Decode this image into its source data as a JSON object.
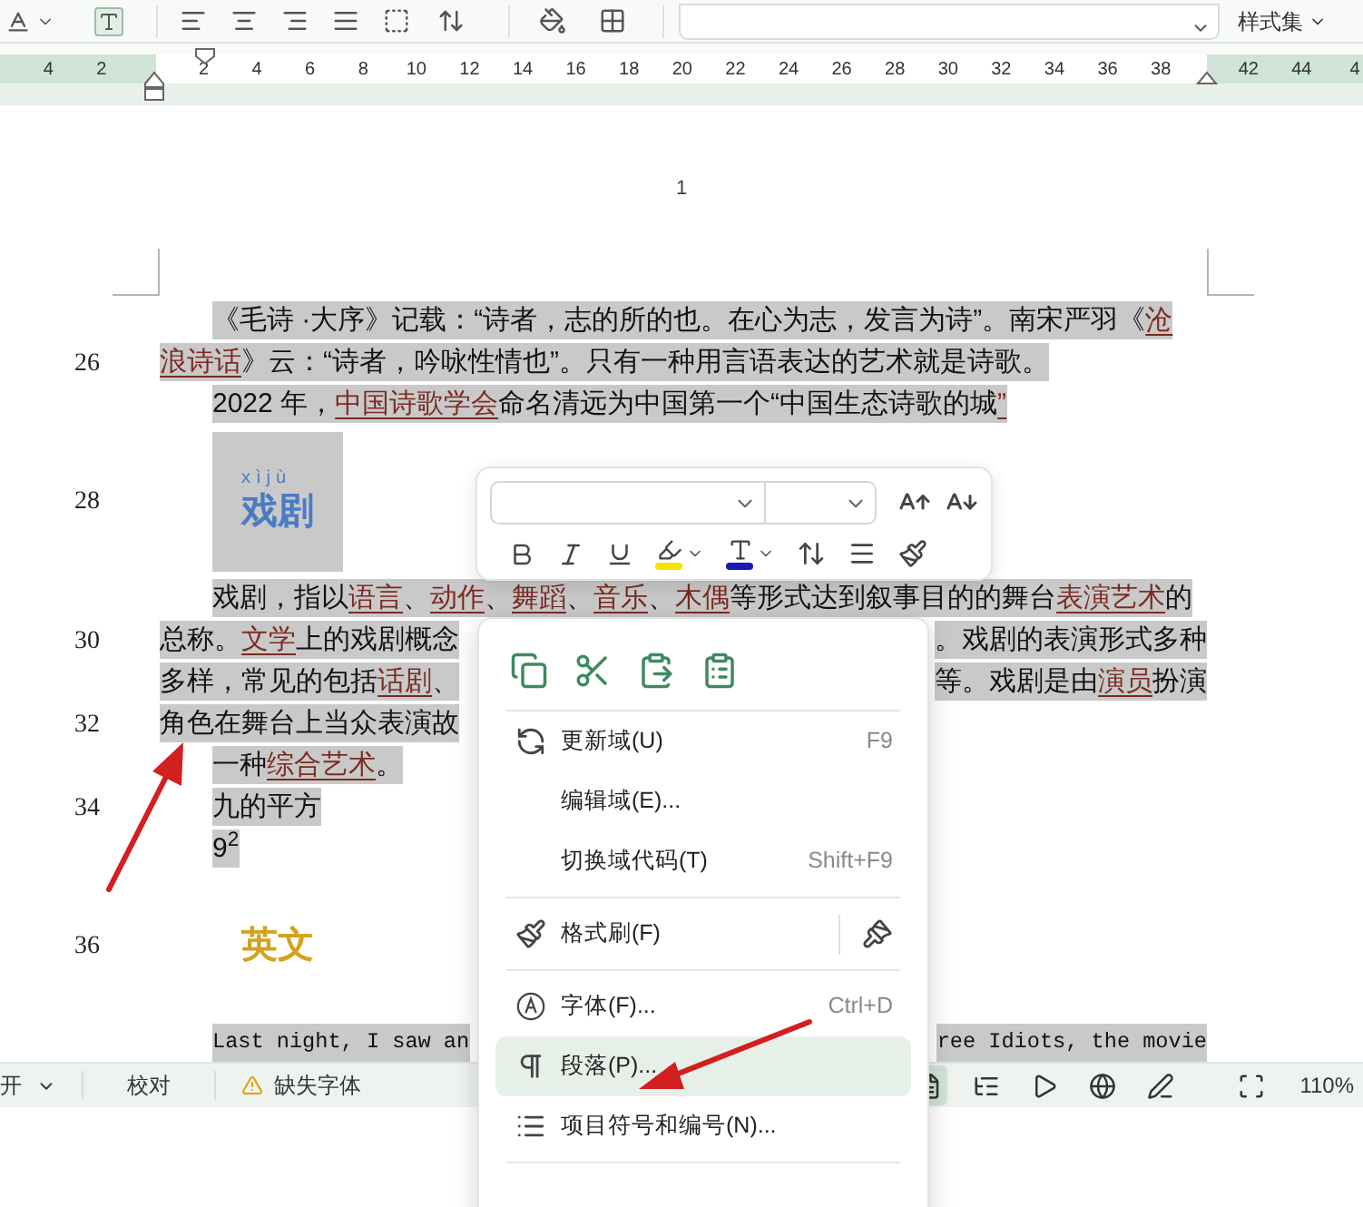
{
  "toolbar": {
    "style_set": "样式集"
  },
  "ruler": {
    "marks": [
      {
        "label": "4",
        "margin": true
      },
      {
        "label": "2",
        "margin": true
      },
      {
        "label": "2",
        "margin": false
      },
      {
        "label": "4",
        "margin": false
      },
      {
        "label": "6",
        "margin": false
      },
      {
        "label": "8",
        "margin": false
      },
      {
        "label": "10",
        "margin": false
      },
      {
        "label": "12",
        "margin": false
      },
      {
        "label": "14",
        "margin": false
      },
      {
        "label": "16",
        "margin": false
      },
      {
        "label": "18",
        "margin": false
      },
      {
        "label": "20",
        "margin": false
      },
      {
        "label": "22",
        "margin": false
      },
      {
        "label": "24",
        "margin": false
      },
      {
        "label": "26",
        "margin": false
      },
      {
        "label": "28",
        "margin": false
      },
      {
        "label": "30",
        "margin": false
      },
      {
        "label": "32",
        "margin": false
      },
      {
        "label": "34",
        "margin": false
      },
      {
        "label": "36",
        "margin": false
      },
      {
        "label": "38",
        "margin": false
      },
      {
        "label": "42",
        "margin": true
      },
      {
        "label": "44",
        "margin": true
      },
      {
        "label": "4",
        "margin": true
      }
    ]
  },
  "page": {
    "header_page_number": "1",
    "lines": [
      {
        "kind": "para",
        "indent": true,
        "highlighted": true,
        "segments": [
          {
            "text": "《毛诗 ·大序》记载：“诗者，志的所的也。在心为志，发言为诗”。南宋严羽《"
          },
          {
            "text": "沧",
            "link": true
          }
        ]
      },
      {
        "kind": "para",
        "line_number": "26",
        "indent": false,
        "highlighted": true,
        "segments": [
          {
            "text": "浪诗话",
            "link": true
          },
          {
            "text": "》云：“诗者，吟咏性情也”。只有一种用言语表达的艺术就是诗歌。"
          }
        ]
      },
      {
        "kind": "para",
        "indent": true,
        "highlighted": true,
        "segments": [
          {
            "text": "2022 年，"
          },
          {
            "text": "中国诗歌学会",
            "link": true
          },
          {
            "text": "命名清远为中国第一个“中国生态诗歌的城"
          },
          {
            "text": "”",
            "link": true
          }
        ]
      },
      {
        "kind": "heading",
        "line_number": "28",
        "highlighted": true,
        "ruby": "xìjù",
        "text": "戏剧",
        "color": "#4a7cc4"
      },
      {
        "kind": "para",
        "indent": true,
        "highlighted": true,
        "segments": [
          {
            "text": "戏剧，指以"
          },
          {
            "text": "语言",
            "link": true
          },
          {
            "text": "、"
          },
          {
            "text": "动作",
            "link": true
          },
          {
            "text": "、"
          },
          {
            "text": "舞蹈",
            "link": true
          },
          {
            "text": "、"
          },
          {
            "text": "音乐",
            "link": true
          },
          {
            "text": "、"
          },
          {
            "text": "木偶",
            "link": true
          },
          {
            "text": "等形式达到叙事目的的舞台"
          },
          {
            "text": "表演艺术",
            "link": true
          },
          {
            "text": "的"
          }
        ]
      },
      {
        "kind": "para",
        "line_number": "30",
        "indent": false,
        "highlighted": true,
        "segments": [
          {
            "text": "总称。"
          },
          {
            "text": "文学",
            "link": true
          },
          {
            "text": "上的戏剧概念"
          }
        ],
        "right_segments": [
          {
            "text": "。戏剧的表演形式多种"
          }
        ]
      },
      {
        "kind": "para",
        "indent": false,
        "highlighted": true,
        "segments": [
          {
            "text": "多样，常见的包括"
          },
          {
            "text": "话剧",
            "link": true
          },
          {
            "text": "、"
          }
        ],
        "right_segments": [
          {
            "text": "等。戏剧是由"
          },
          {
            "text": "演员",
            "link": true
          },
          {
            "text": "扮演"
          }
        ]
      },
      {
        "kind": "para",
        "line_number": "32",
        "indent": false,
        "highlighted": true,
        "segments": [
          {
            "text": "角色在舞台上当众表演故"
          }
        ]
      },
      {
        "kind": "para",
        "indent": true,
        "highlighted": true,
        "segments": [
          {
            "text": "一种"
          },
          {
            "text": "综合艺术",
            "link": true
          },
          {
            "text": "。"
          }
        ]
      },
      {
        "kind": "para",
        "line_number": "34",
        "indent": true,
        "highlighted": true,
        "segments": [
          {
            "text": "九的平方"
          }
        ]
      },
      {
        "kind": "para",
        "indent": true,
        "highlighted": true,
        "segments": [
          {
            "text": "9$^{2}$"
          }
        ]
      },
      {
        "kind": "heading",
        "line_number": "36",
        "highlighted": false,
        "text": "英文",
        "color": "#d4a21e"
      },
      {
        "kind": "mono",
        "indent": true,
        "highlighted": true,
        "segments": [
          {
            "text": "Last night, I saw an"
          }
        ],
        "right_segments": [
          {
            "text": "ree Idiots, the movie"
          }
        ]
      }
    ]
  },
  "context_menu": {
    "items": [
      {
        "kind": "item",
        "label": "更新域(U)",
        "shortcut": "F9",
        "selected": false
      },
      {
        "kind": "item",
        "label": "编辑域(E)...",
        "selected": false
      },
      {
        "kind": "item",
        "label": "切换域代码(T)",
        "shortcut": "Shift+F9",
        "selected": false
      },
      {
        "kind": "divider"
      },
      {
        "kind": "split",
        "label": "格式刷(F)",
        "selected": false
      },
      {
        "kind": "divider"
      },
      {
        "kind": "item",
        "label": "字体(F)...",
        "shortcut": "Ctrl+D",
        "selected": false
      },
      {
        "kind": "item",
        "label": "段落(P)...",
        "selected": true
      },
      {
        "kind": "item",
        "label": "项目符号和编号(N)...",
        "selected": false
      },
      {
        "kind": "divider"
      }
    ]
  },
  "status_bar": {
    "items": [
      {
        "kind": "dropdown",
        "label": "开"
      },
      {
        "kind": "plain",
        "label": "校对"
      },
      {
        "kind": "warning",
        "label": "缺失字体"
      }
    ],
    "view_buttons": [
      {
        "selected": true
      },
      {
        "selected": false
      },
      {
        "selected": false
      },
      {
        "selected": false
      },
      {
        "selected": false
      },
      {
        "selected": false
      }
    ],
    "zoom": "110%"
  }
}
